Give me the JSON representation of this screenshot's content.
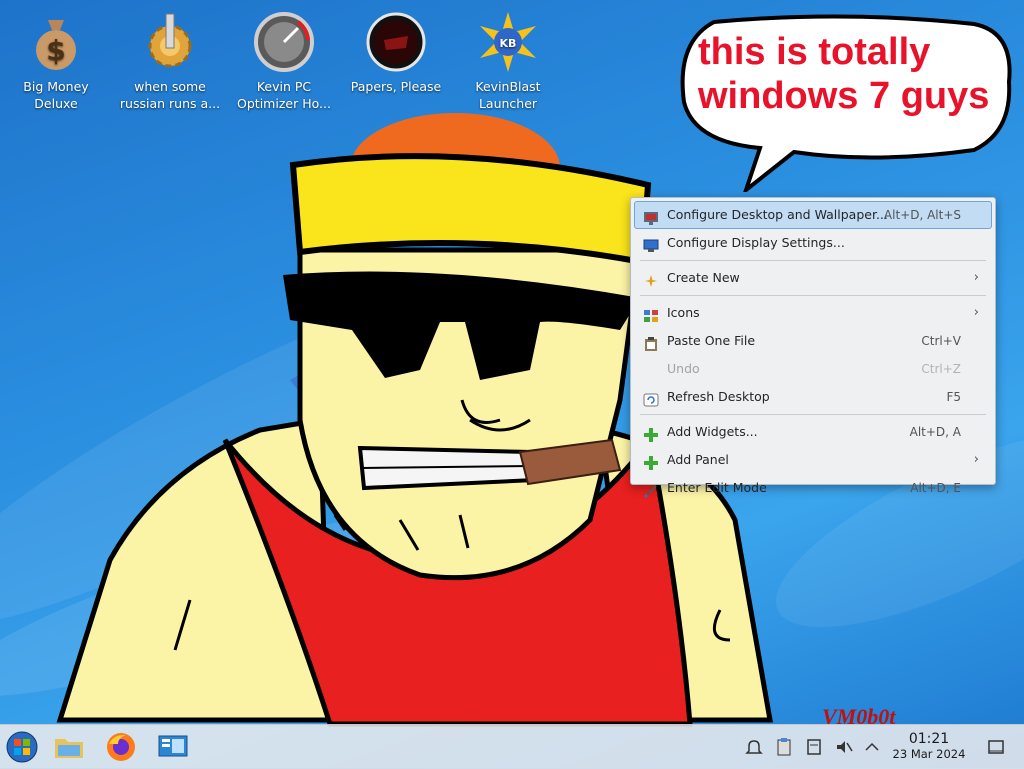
{
  "desktop": {
    "icons": [
      {
        "label": "Big Money Deluxe",
        "icon": "money-bag-icon"
      },
      {
        "label": "when some russian runs a...",
        "icon": "gear-icon"
      },
      {
        "label": "Kevin PC Optimizer Ho...",
        "icon": "gauge-icon"
      },
      {
        "label": "Papers, Please",
        "icon": "papers-please-icon"
      },
      {
        "label": "KevinBlast Launcher",
        "icon": "starburst-icon"
      }
    ],
    "bubble_text": "this is totally\nwindows 7 guys",
    "watermark": "VM0b0t"
  },
  "context_menu": {
    "items": [
      {
        "label": "Configure Desktop and Wallpaper...",
        "shortcut": "Alt+D, Alt+S",
        "icon": "desktop-settings-icon",
        "highlighted": true
      },
      {
        "label": "Configure Display Settings...",
        "shortcut": "",
        "icon": "display-icon"
      },
      {
        "label": "Create New",
        "shortcut": "",
        "icon": "new-sparkle-icon",
        "submenu": true
      },
      {
        "label": "Icons",
        "shortcut": "",
        "icon": "icons-grid-icon",
        "submenu": true
      },
      {
        "label": "Paste One File",
        "shortcut": "Ctrl+V",
        "icon": "paste-icon"
      },
      {
        "label": "Undo",
        "shortcut": "Ctrl+Z",
        "icon": "undo-icon",
        "disabled": true
      },
      {
        "label": "Refresh Desktop",
        "shortcut": "F5",
        "icon": "refresh-icon"
      },
      {
        "label": "Add Widgets...",
        "shortcut": "Alt+D, A",
        "icon": "plus-icon"
      },
      {
        "label": "Add Panel",
        "shortcut": "",
        "icon": "plus-icon",
        "submenu": true
      },
      {
        "label": "Enter Edit Mode",
        "shortcut": "Alt+D, E",
        "icon": "edit-icon"
      }
    ]
  },
  "taskbar": {
    "clock_time": "01:21",
    "clock_date": "23 Mar 2024"
  }
}
